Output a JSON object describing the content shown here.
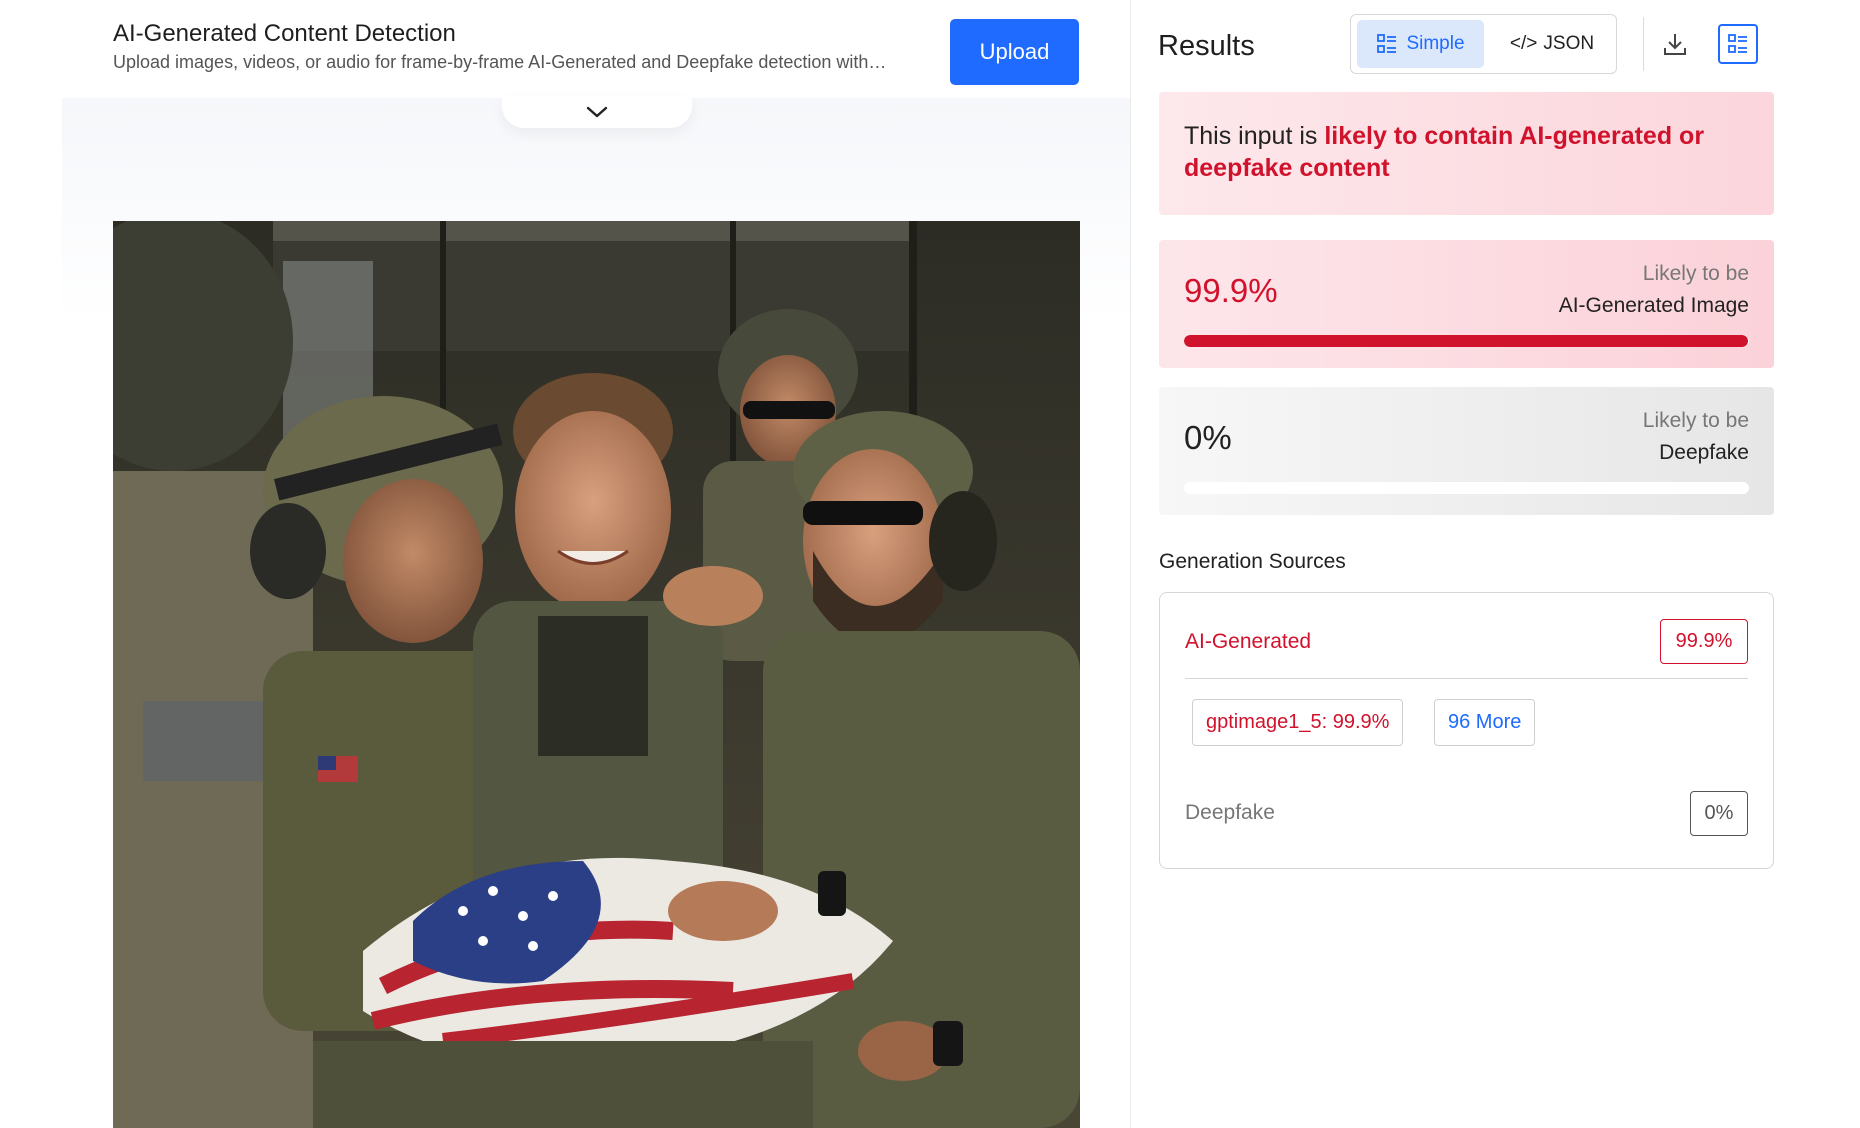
{
  "header": {
    "title": "AI-Generated Content Detection",
    "subtitle": "Upload images, videos, or audio for frame-by-frame AI-Generated and Deepfake detection with…",
    "upload_label": "Upload"
  },
  "viewer": {
    "collapse_icon": "chevron-down-icon",
    "image_icon": "military-group-photo"
  },
  "results": {
    "title": "Results",
    "view_toggle": {
      "simple_label": "Simple",
      "simple_icon": "list-layout-icon",
      "json_label": "JSON",
      "json_icon": "code-icon",
      "selected": "Simple"
    },
    "download_icon": "download-icon",
    "list_view_icon": "list-view-icon",
    "verdict": {
      "prefix": "This input is ",
      "emphasis": "likely to contain AI-generated or deepfake content"
    },
    "scores": [
      {
        "percent_label": "99.9%",
        "value": 0.999,
        "label_top": "Likely to be",
        "label_main": "AI-Generated Image"
      },
      {
        "percent_label": "0%",
        "value": 0,
        "label_top": "Likely to be",
        "label_main": "Deepfake"
      }
    ],
    "generation_sources": {
      "title": "Generation Sources",
      "ai": {
        "label": "AI-Generated",
        "badge": "99.9%"
      },
      "chips": [
        {
          "label": "gptimage1_5: 99.9%"
        },
        {
          "label": "96 More"
        }
      ],
      "deepfake": {
        "label": "Deepfake",
        "badge": "0%"
      }
    }
  },
  "colors": {
    "accent_blue": "#1f6bff",
    "alert_red": "#d1122c"
  }
}
